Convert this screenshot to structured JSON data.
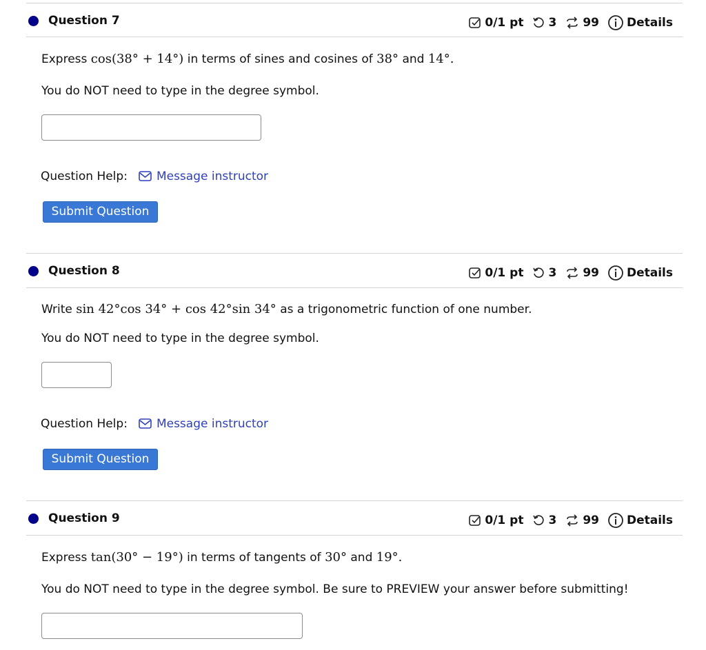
{
  "common": {
    "points": "0/1 pt",
    "retries": "3",
    "attempts": "99",
    "details_label": "Details",
    "help_label": "Question Help:",
    "message_label": "Message instructor",
    "submit_label": "Submit Question",
    "degree_note": "You do NOT need to type in the degree symbol."
  },
  "questions": [
    {
      "title": "Question 7",
      "prompt_pre": "Express ",
      "prompt_math": "cos(38° + 14°)",
      "prompt_mid": " in terms of sines and cosines of ",
      "math_a": "38°",
      "prompt_and": " and ",
      "math_b": "14°",
      "prompt_end": "."
    },
    {
      "title": "Question 8",
      "prompt_pre": "Write ",
      "prompt_math": "sin 42°cos 34° + cos 42°sin 34°",
      "prompt_post": " as a trigonometric function of one number."
    },
    {
      "title": "Question 9",
      "prompt_pre": "Express ",
      "prompt_math": "tan(30° − 19°)",
      "prompt_mid": " in terms of tangents of ",
      "math_a": "30°",
      "prompt_and": " and ",
      "math_b": "19°",
      "prompt_end": ".",
      "note": "You do NOT need to type in the degree symbol. Be sure to PREVIEW your answer before submitting!"
    }
  ]
}
